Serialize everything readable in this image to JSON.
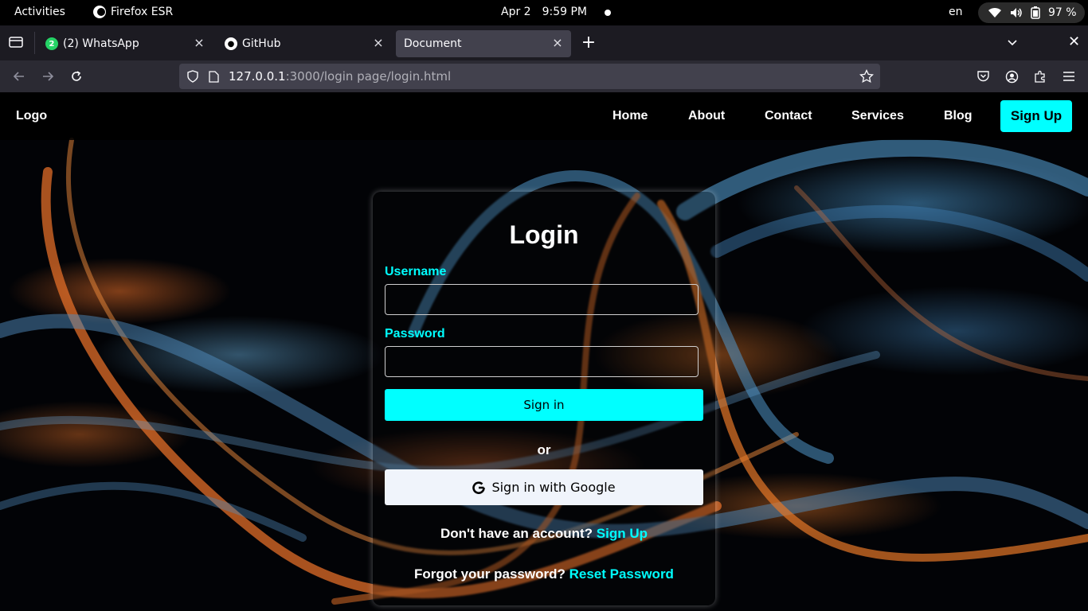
{
  "system_bar": {
    "activities": "Activities",
    "app_name": "Firefox ESR",
    "date": "Apr 2",
    "time": "9:59 PM",
    "language": "en",
    "battery": "97 %"
  },
  "browser": {
    "tabs": [
      {
        "title": "(2) WhatsApp",
        "badge": "2",
        "icon": "whatsapp-icon"
      },
      {
        "title": "GitHub",
        "icon": "github-icon"
      },
      {
        "title": "Document",
        "active": true
      }
    ],
    "url_host": "127.0.0.1",
    "url_rest": ":3000/login page/login.html"
  },
  "site": {
    "logo": "Logo",
    "nav": [
      "Home",
      "About",
      "Contact",
      "Services",
      "Blog"
    ],
    "signup": "Sign Up",
    "accent": "#00ffff"
  },
  "login": {
    "title": "Login",
    "username_label": "Username",
    "password_label": "Password",
    "signin": "Sign in",
    "or": "or",
    "google": "Sign in with Google",
    "no_account": "Don't have an account?",
    "signup_link": "Sign Up",
    "forgot": "Forgot your password?",
    "reset_link": "Reset Password"
  }
}
